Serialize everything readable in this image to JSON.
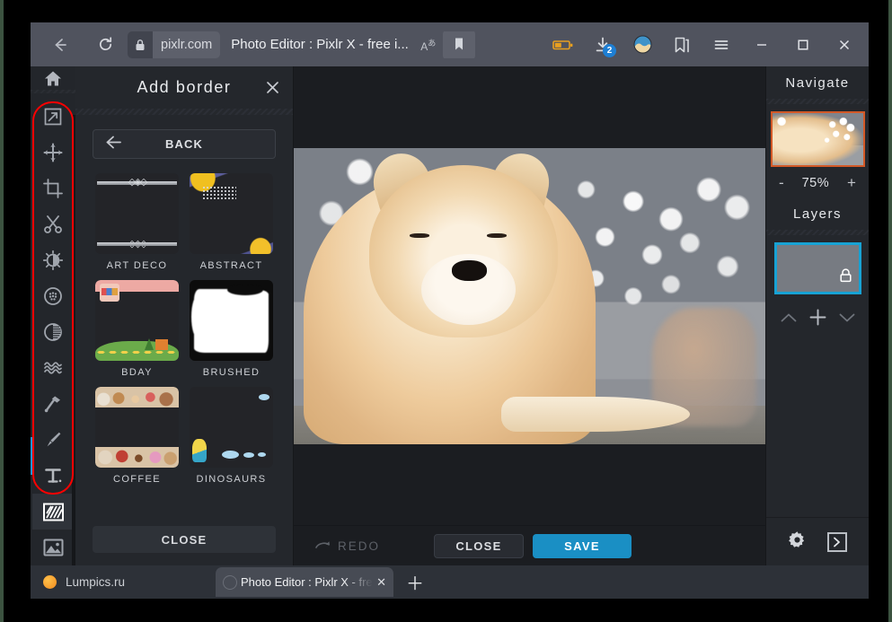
{
  "browser": {
    "back_icon": "back-arrow-icon",
    "reload_icon": "reload-icon",
    "lock_icon": "lock-icon",
    "domain": "pixlr.com",
    "page_title": "Photo Editor : Pixlr X - free i...",
    "translate_icon": "translate-icon",
    "translate_label": "A",
    "bookmark_icon": "bookmark-filled-icon",
    "battery_icon": "battery-icon",
    "download_icon": "download-icon",
    "download_badge": "2",
    "profile_icon": "profile-avatar-icon",
    "collections_icon": "collections-icon",
    "menu_icon": "hamburger-menu-icon",
    "minimize": "–",
    "maximize": "□",
    "close": "✕"
  },
  "toolbar": {
    "home_icon": "home-icon",
    "tools": [
      {
        "name": "arrange-tool",
        "icon": "arrange-icon"
      },
      {
        "name": "move-tool",
        "icon": "move-arrows-icon"
      },
      {
        "name": "crop-tool",
        "icon": "crop-icon"
      },
      {
        "name": "cutout-tool",
        "icon": "scissors-icon"
      },
      {
        "name": "adjust-tool",
        "icon": "brightness-contrast-icon"
      },
      {
        "name": "effects-tool",
        "icon": "effects-circle-icon"
      },
      {
        "name": "retouch-tool",
        "icon": "retouch-icon"
      },
      {
        "name": "liquify-tool",
        "icon": "liquify-waves-icon"
      },
      {
        "name": "draw-tool",
        "icon": "paint-bucket-icon"
      },
      {
        "name": "brush-tool",
        "icon": "paintbrush-icon"
      },
      {
        "name": "text-tool",
        "icon": "text-t-icon"
      },
      {
        "name": "border-tool",
        "icon": "border-hatch-icon",
        "selected": true
      },
      {
        "name": "add-image-tool",
        "icon": "add-image-icon"
      }
    ]
  },
  "border_panel": {
    "title": "Add border",
    "close_icon": "close-x-icon",
    "back_label": "BACK",
    "back_icon": "back-arrow-icon",
    "close_label": "CLOSE",
    "borders": [
      {
        "label": "ART DECO",
        "style": "tb-artdeco"
      },
      {
        "label": "ABSTRACT",
        "style": "tb-abstract"
      },
      {
        "label": "BDAY",
        "style": "tb-bday"
      },
      {
        "label": "BRUSHED",
        "style": "tb-brushed"
      },
      {
        "label": "COFFEE",
        "style": "tb-coffee"
      },
      {
        "label": "DINOSAURS",
        "style": "tb-dino"
      }
    ]
  },
  "canvas": {
    "image_alt": "akita-dog-photo",
    "redo_label": "REDO",
    "redo_icon": "redo-arrow-icon",
    "redo_disabled": true,
    "close_label": "CLOSE",
    "save_label": "SAVE",
    "save_color": "#1a8fc4"
  },
  "navigate": {
    "title": "Navigate",
    "thumbnail": "navigate-preview",
    "zoom_out": "-",
    "zoom_value": "75%",
    "zoom_in": "+"
  },
  "layers": {
    "title": "Layers",
    "thumbnail": "layer-preview",
    "lock_icon": "lock-icon",
    "selected_border_color": "#17a2d4",
    "move_up_icon": "chevron-up-icon",
    "add_icon": "plus-icon",
    "move_down_icon": "chevron-down-icon",
    "settings_icon": "gear-icon",
    "expand_icon": "expand-panel-icon"
  },
  "taskbar": {
    "site_label": "Lumpics.ru",
    "site_icon": "orange-dot-icon",
    "tab_title": "Photo Editor : Pixlr X - fre",
    "tab_close_icon": "close-x-icon",
    "new_tab_icon": "plus-icon"
  },
  "annotation": {
    "highlight_color": "#ff0000",
    "target": "tool-rail"
  }
}
